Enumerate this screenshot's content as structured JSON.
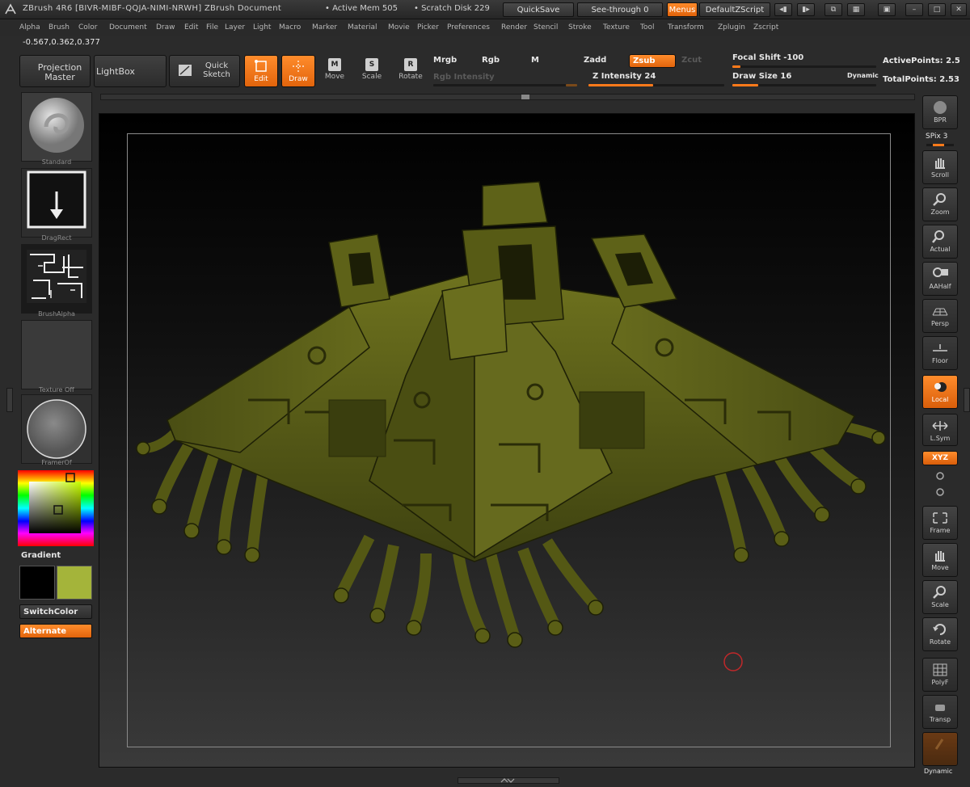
{
  "titlebar": {
    "title": "ZBrush 4R6 [BIVR-MIBF-QQJA-NIMI-NRWH]   ZBrush Document",
    "active_mem": "• Active Mem 505",
    "scratch_disk": "• Scratch Disk 229",
    "quicksave": "QuickSave",
    "see_through": "See-through   0",
    "menus": "Menus",
    "default_zscript": "DefaultZScript"
  },
  "menubar": {
    "items": [
      "Alpha",
      "Brush",
      "Color",
      "Document",
      "Draw",
      "Edit",
      "File",
      "Layer",
      "Light",
      "Macro",
      "Marker",
      "Material",
      "Movie",
      "Picker",
      "Preferences",
      "Render",
      "Stencil",
      "Stroke",
      "Texture",
      "Tool",
      "Transform",
      "Zplugin",
      "Zscript"
    ]
  },
  "coords": "-0.567,0.362,0.377",
  "toolbar": {
    "projection_master": "Projection Master",
    "lightbox": "LightBox",
    "quick_sketch": "Quick Sketch",
    "edit": "Edit",
    "draw": "Draw",
    "move": "Move",
    "move_key": "M",
    "scale": "Scale",
    "scale_key": "S",
    "rotate": "Rotate",
    "rotate_key": "R",
    "mrgb": "Mrgb",
    "rgb": "Rgb",
    "m": "M",
    "rgb_intensity": "Rgb Intensity",
    "zadd": "Zadd",
    "zsub": "Zsub",
    "zcut": "Zcut",
    "z_intensity": "Z Intensity 24",
    "z_intensity_value": 24,
    "focal_shift": "Focal Shift -100",
    "focal_shift_value": -100,
    "draw_size": "Draw Size 16",
    "draw_size_value": 16,
    "dynamic": "Dynamic",
    "active_points": "ActivePoints: 2.5",
    "total_points": "TotalPoints: 2.53"
  },
  "left_shelf": {
    "brush_label": "Standard",
    "stroke_label": "DragRect",
    "alpha_label": "BrushAlpha",
    "texture_label": "Texture Off",
    "material_label": "FramerOf",
    "gradient_label": "Gradient",
    "switch_color": "SwitchColor",
    "alternate": "Alternate",
    "main_color": "#000000",
    "secondary_color": "#a4b43a"
  },
  "right_shelf": {
    "bpr": "BPR",
    "spix": "SPix 3",
    "scroll": "Scroll",
    "zoom": "Zoom",
    "actual": "Actual",
    "aahalf": "AAHalf",
    "persp": "Persp",
    "floor": "Floor",
    "local": "Local",
    "lsym": "L.Sym",
    "xyz": "XYZ",
    "frame": "Frame",
    "move": "Move",
    "scale": "Scale",
    "rotate": "Rotate",
    "polyf": "PolyF",
    "transp": "Transp",
    "dynamic": "Dynamic"
  },
  "colors": {
    "accent": "#ff7a1a",
    "model": "#5a5e16"
  }
}
